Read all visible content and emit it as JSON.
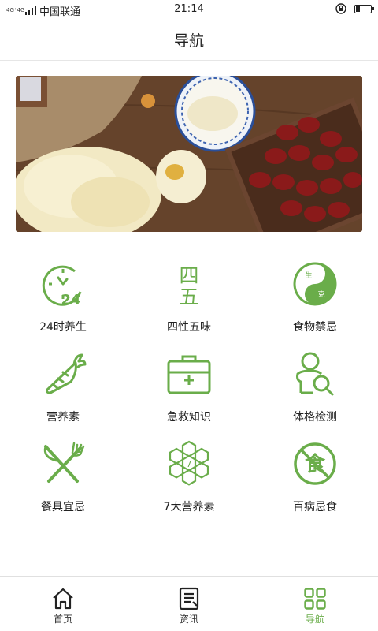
{
  "status_bar": {
    "network": "4G⁺4G",
    "carrier": "中国联通",
    "time": "21:14",
    "battery_level": 0.3
  },
  "header": {
    "title": "导航"
  },
  "colors": {
    "accent": "#6aad4a",
    "text": "#222222"
  },
  "grid": {
    "items": [
      {
        "label": "24时养生",
        "icon": "clock-24-icon"
      },
      {
        "label": "四性五味",
        "icon": "four-five-chars-icon"
      },
      {
        "label": "食物禁忌",
        "icon": "yin-yang-icon"
      },
      {
        "label": "营养素",
        "icon": "carrot-icon"
      },
      {
        "label": "急救知识",
        "icon": "first-aid-kit-icon"
      },
      {
        "label": "体格检测",
        "icon": "body-check-icon"
      },
      {
        "label": "餐具宜忌",
        "icon": "fork-knife-icon"
      },
      {
        "label": "7大营养素",
        "icon": "honeycomb-icon"
      },
      {
        "label": "百病忌食",
        "icon": "no-food-icon"
      }
    ],
    "clock_text": "24",
    "four_char": "四",
    "five_char": "五",
    "yinyang_top": "生",
    "yinyang_bottom": "克",
    "honeycomb_num": "7",
    "no_food_char": "食"
  },
  "tabbar": {
    "tabs": [
      {
        "label": "首页",
        "icon": "home-icon"
      },
      {
        "label": "资讯",
        "icon": "news-icon"
      },
      {
        "label": "导航",
        "icon": "grid-nav-icon",
        "active": true
      }
    ]
  }
}
